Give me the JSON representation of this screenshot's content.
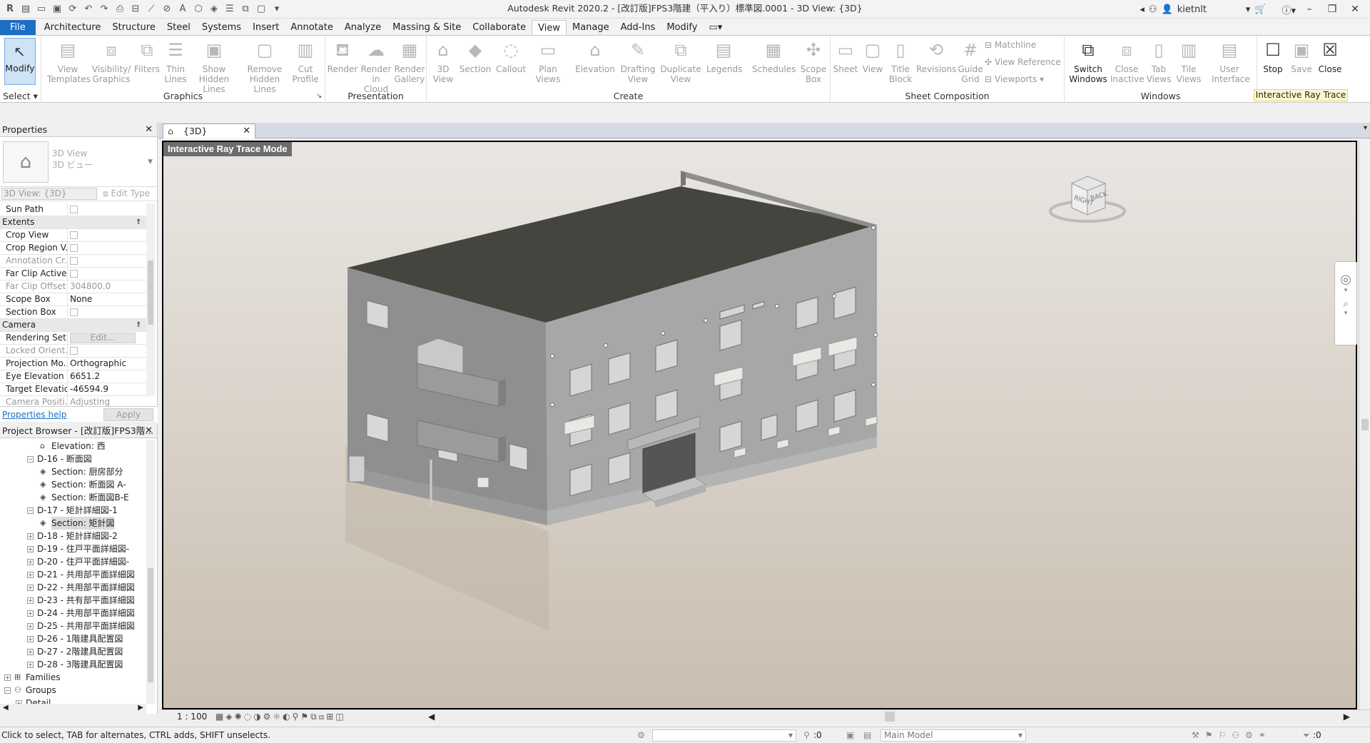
{
  "app": {
    "title": "Autodesk Revit 2020.2 - [改訂版]FPS3階建（平入り）標準図.0001 - 3D View: {3D}",
    "user": "kietnlt"
  },
  "ribbon": {
    "tabs": [
      "File",
      "Architecture",
      "Structure",
      "Steel",
      "Systems",
      "Insert",
      "Annotate",
      "Analyze",
      "Massing & Site",
      "Collaborate",
      "View",
      "Manage",
      "Add-Ins",
      "Modify"
    ],
    "active_tab": "View",
    "select_label": "Select",
    "modify_label": "Modify",
    "panels": {
      "graphics": "Graphics",
      "presentation": "Presentation",
      "create": "Create",
      "sheet_composition": "Sheet Composition",
      "windows": "Windows",
      "interactive_ray_trace": "Interactive Ray Trace"
    },
    "buttons": {
      "view_templates": [
        "View",
        "Templates"
      ],
      "visibility_graphics": [
        "Visibility/",
        "Graphics"
      ],
      "filters": [
        "Filters",
        ""
      ],
      "thin_lines": [
        "Thin",
        "Lines"
      ],
      "show_hidden": [
        "Show",
        "Hidden Lines"
      ],
      "remove_hidden": [
        "Remove",
        "Hidden Lines"
      ],
      "cut_profile": [
        "Cut",
        "Profile"
      ],
      "render": [
        "Render",
        ""
      ],
      "render_cloud": [
        "Render",
        "in Cloud"
      ],
      "render_gallery": [
        "Render",
        "Gallery"
      ],
      "view_3d": [
        "3D",
        "View"
      ],
      "section": [
        "Section",
        ""
      ],
      "callout": [
        "Callout",
        ""
      ],
      "plan_views": [
        "Plan",
        "Views"
      ],
      "elevation": [
        "Elevation",
        ""
      ],
      "drafting_view": [
        "Drafting",
        "View"
      ],
      "duplicate_view": [
        "Duplicate",
        "View"
      ],
      "legends": [
        "Legends",
        ""
      ],
      "schedules": [
        "Schedules",
        ""
      ],
      "scope_box": [
        "Scope",
        "Box"
      ],
      "sheet": [
        "Sheet",
        ""
      ],
      "view": [
        "View",
        ""
      ],
      "title_block": [
        "Title",
        "Block"
      ],
      "revisions": [
        "Revisions",
        ""
      ],
      "guide_grid": [
        "Guide",
        "Grid"
      ],
      "matchline": "Matchline",
      "view_reference": "View  Reference",
      "viewports": "Viewports",
      "switch_windows": [
        "Switch",
        "Windows"
      ],
      "close_inactive": [
        "Close",
        "Inactive"
      ],
      "tab_views": [
        "Tab",
        "Views"
      ],
      "tile_views": [
        "Tile",
        "Views"
      ],
      "user_interface": [
        "User",
        "Interface"
      ],
      "stop": [
        "Stop",
        ""
      ],
      "save": [
        "Save",
        ""
      ],
      "close": [
        "Close",
        ""
      ]
    }
  },
  "properties": {
    "title": "Properties",
    "type_line1": "3D View",
    "type_line2": "3D ビュー",
    "instance_select": "3D View: {3D}",
    "edit_type": "Edit Type",
    "rows": [
      {
        "k": "Sun Path",
        "v": "",
        "cb": true
      },
      {
        "k": "Extents",
        "group": true
      },
      {
        "k": "Crop View",
        "v": "",
        "cb": true
      },
      {
        "k": "Crop Region V...",
        "v": "",
        "cb": true
      },
      {
        "k": "Annotation Cr...",
        "v": "",
        "cb": true,
        "grey": true
      },
      {
        "k": "Far Clip Active",
        "v": "",
        "cb": true
      },
      {
        "k": "Far Clip Offset",
        "v": "304800.0",
        "grey": true
      },
      {
        "k": "Scope Box",
        "v": "None"
      },
      {
        "k": "Section Box",
        "v": "",
        "cb": true
      },
      {
        "k": "Camera",
        "group": true
      },
      {
        "k": "Rendering Set...",
        "v": "Edit...",
        "btn": true
      },
      {
        "k": "Locked Orient...",
        "v": "",
        "cb": true,
        "grey": true
      },
      {
        "k": "Projection Mo...",
        "v": "Orthographic"
      },
      {
        "k": "Eye Elevation",
        "v": "6651.2"
      },
      {
        "k": "Target Elevation",
        "v": "-46594.9"
      },
      {
        "k": "Camera Positi...",
        "v": "Adjusting",
        "grey": true
      }
    ],
    "help": "Properties help",
    "apply": "Apply"
  },
  "browser": {
    "title": "Project Browser - [改訂版]FPS3階...",
    "nodes": [
      {
        "lvl": 3,
        "icon": "elev",
        "label": "Elevation: 西"
      },
      {
        "lvl": 2,
        "exp": "−",
        "label": "D-16 - 断面図"
      },
      {
        "lvl": 3,
        "icon": "sec",
        "label": "Section: 厨房部分"
      },
      {
        "lvl": 3,
        "icon": "sec",
        "label": "Section: 断面図 A-"
      },
      {
        "lvl": 3,
        "icon": "sec",
        "label": "Section: 断面図B-E"
      },
      {
        "lvl": 2,
        "exp": "−",
        "label": "D-17 - 矩計詳細図-1"
      },
      {
        "lvl": 3,
        "icon": "sec",
        "label": "Section: 矩計図",
        "sel": true
      },
      {
        "lvl": 2,
        "exp": "+",
        "label": "D-18 - 矩計詳細図-2"
      },
      {
        "lvl": 2,
        "exp": "+",
        "label": "D-19 - 住戸平面詳細図-"
      },
      {
        "lvl": 2,
        "exp": "+",
        "label": "D-20 - 住戸平面詳細図-"
      },
      {
        "lvl": 2,
        "exp": "+",
        "label": "D-21 - 共用部平面詳細図"
      },
      {
        "lvl": 2,
        "exp": "+",
        "label": "D-22 - 共用部平面詳細図"
      },
      {
        "lvl": 2,
        "exp": "+",
        "label": "D-23 - 共有部平面詳細図"
      },
      {
        "lvl": 2,
        "exp": "+",
        "label": "D-24 - 共用部平面詳細図"
      },
      {
        "lvl": 2,
        "exp": "+",
        "label": "D-25 - 共用部平面詳細図"
      },
      {
        "lvl": 2,
        "exp": "+",
        "label": "D-26 - 1階建具配置図"
      },
      {
        "lvl": 2,
        "exp": "+",
        "label": "D-27 - 2階建具配置図"
      },
      {
        "lvl": 2,
        "exp": "+",
        "label": "D-28 - 3階建具配置図"
      },
      {
        "lvl": 0,
        "exp": "+",
        "icon": "fam",
        "label": "Families"
      },
      {
        "lvl": 0,
        "exp": "−",
        "icon": "grp",
        "label": "Groups"
      },
      {
        "lvl": 1,
        "exp": "+",
        "label": "Detail"
      }
    ]
  },
  "view": {
    "tab_label": "{3D}",
    "mode_label": "Interactive Ray Trace Mode",
    "scale": "1 : 100",
    "viewcube_right": "RIGHT",
    "viewcube_back": "BACK"
  },
  "status": {
    "hint": "Click to select, TAB for alternates, CTRL adds, SHIFT unselects.",
    "selection_count": ":0",
    "model": "Main Model",
    "filter_count": ":0"
  }
}
